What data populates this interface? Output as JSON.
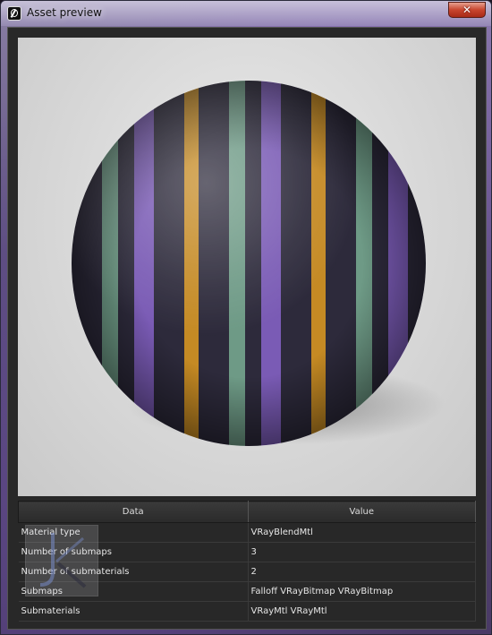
{
  "window": {
    "title": "Asset preview",
    "close_label": "✕"
  },
  "table": {
    "headers": [
      "Data",
      "Value"
    ],
    "rows": [
      {
        "data": "Material type",
        "value": "VRayBlendMtl"
      },
      {
        "data": "Number of submaps",
        "value": "3"
      },
      {
        "data": "Number of submaterials",
        "value": "2"
      },
      {
        "data": "Submaps",
        "value": "Falloff VRayBitmap VRayBitmap"
      },
      {
        "data": "Submaterials",
        "value": "VRayMtl VRayMtl"
      }
    ]
  },
  "colors": {
    "stripe_dark": "#2d2a3b",
    "stripe_green": "#6e9a86",
    "stripe_purple": "#7a5bb5",
    "stripe_orange": "#c58a24"
  }
}
